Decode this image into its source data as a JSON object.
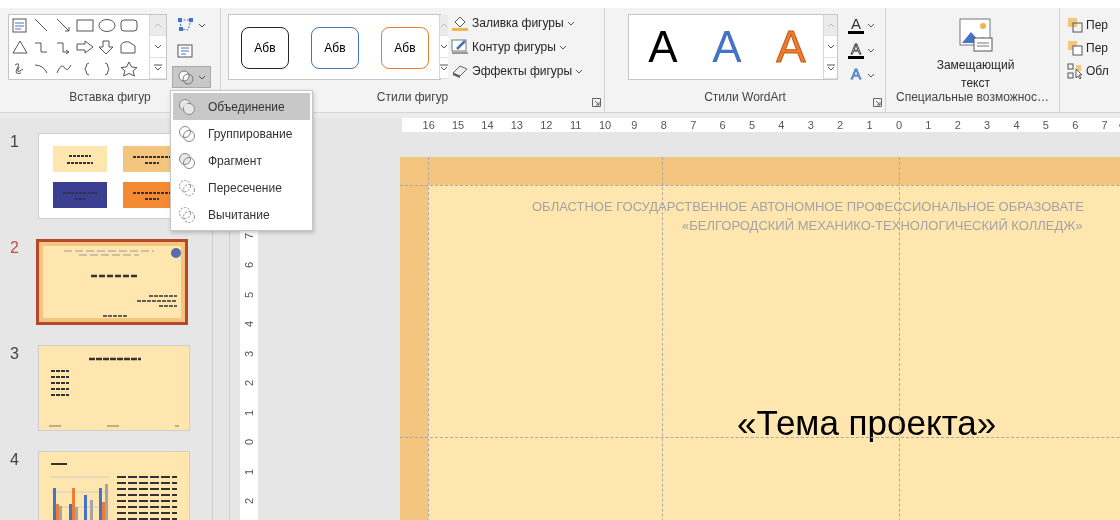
{
  "ribbon": {
    "groups": [
      {
        "kind": "insert_shapes",
        "label": "Вставка фигур",
        "merge_pressed": true
      },
      {
        "kind": "shape_styles",
        "label": "Стили фигур",
        "styles": [
          {
            "text": "Абв",
            "color": "#262626"
          },
          {
            "text": "Абв",
            "color": "#4472c4"
          },
          {
            "text": "Абв",
            "color": "#ed7d31"
          }
        ],
        "commands": [
          "Заливка фигуры",
          "Контур фигуры",
          "Эффекты фигуры"
        ]
      },
      {
        "kind": "wordart",
        "label": "Стили WordArt",
        "letters": [
          {
            "text": "A",
            "color": "#000000"
          },
          {
            "text": "A",
            "color": "#4472c4"
          },
          {
            "text": "A",
            "color": "#ed7d31"
          }
        ],
        "format_icons": [
          "A",
          "A",
          "A"
        ]
      },
      {
        "kind": "accessibility",
        "label": "Специальные возможнос…",
        "button": "Замещающий текст"
      },
      {
        "kind": "arrange",
        "commands": [
          "Пер",
          "Пер",
          "Обл"
        ]
      }
    ]
  },
  "merge_menu": {
    "items": [
      {
        "label": "Объединение",
        "selected": true
      },
      {
        "label": "Группирование",
        "selected": false
      },
      {
        "label": "Фрагмент",
        "selected": false
      },
      {
        "label": "Пересечение",
        "selected": false
      },
      {
        "label": "Вычитание",
        "selected": false
      }
    ]
  },
  "thumbnails": [
    {
      "number": "1",
      "kind": "blocks",
      "selected": false
    },
    {
      "number": "2",
      "kind": "title",
      "selected": true
    },
    {
      "number": "3",
      "kind": "list",
      "selected": false
    },
    {
      "number": "4",
      "kind": "chart",
      "selected": false
    }
  ],
  "ruler": {
    "horizontal": [
      "16",
      "15",
      "14",
      "13",
      "12",
      "11",
      "10",
      "9",
      "8",
      "7",
      "6",
      "5",
      "4",
      "3",
      "2",
      "1",
      "0",
      "1",
      "2",
      "3",
      "4",
      "5",
      "6",
      "7"
    ],
    "vertical": [
      "7",
      "6",
      "5",
      "4",
      "3",
      "2",
      "1",
      "0",
      "1",
      "2"
    ]
  },
  "slide": {
    "header": [
      "ОБЛАСТНОЕ ГОСУДАРСТВЕННОЕ АВТОНОМНОЕ ПРОФЕССИОНАЛЬНОЕ ОБРАЗОВАТЕ",
      "«БЕЛГОРОДСКИЙ МЕХАНИКО-ТЕХНОЛОГИЧЕСКИЙ КОЛЛЕДЖ»"
    ],
    "title": "«Тема проекта»"
  }
}
